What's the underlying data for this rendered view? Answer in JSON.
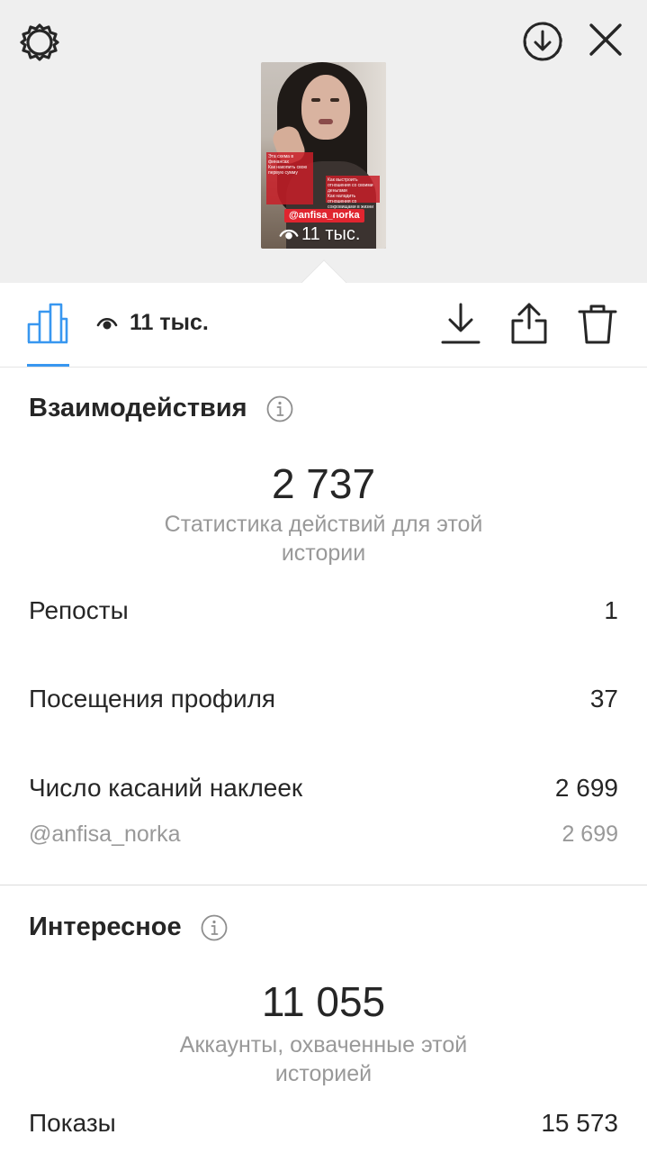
{
  "header": {
    "icons": [
      "settings-icon",
      "download-circle-icon",
      "close-icon"
    ]
  },
  "story_preview": {
    "mention": "@anfisa_norka",
    "views_overlay": "11 тыс.",
    "notes": [
      "Эта схема в финансах",
      "Как накопить свою первую сумму",
      "Как выстроить отношения со своими деньгами",
      "Как наладить отношения со сокровищами в жизни"
    ]
  },
  "toolbar": {
    "views": "11 тыс.",
    "icons": [
      "insights-bar-icon",
      "eye-icon",
      "download-icon",
      "share-icon",
      "trash-icon"
    ],
    "accent": "#3897f0"
  },
  "interactions": {
    "title": "Взаимодействия",
    "total": "2 737",
    "caption": "Статистика действий для этой истории",
    "rows": [
      {
        "label": "Репосты",
        "value": "1"
      },
      {
        "label": "Посещения профиля",
        "value": "37"
      },
      {
        "label": "Число касаний наклеек",
        "value": "2 699"
      }
    ],
    "sub_row": {
      "label": "@anfisa_norka",
      "value": "2 699"
    }
  },
  "discovery": {
    "title": "Интересное",
    "total": "11 055",
    "caption": "Аккаунты, охваченные этой историей",
    "rows": [
      {
        "label": "Показы",
        "value": "15 573"
      }
    ]
  }
}
